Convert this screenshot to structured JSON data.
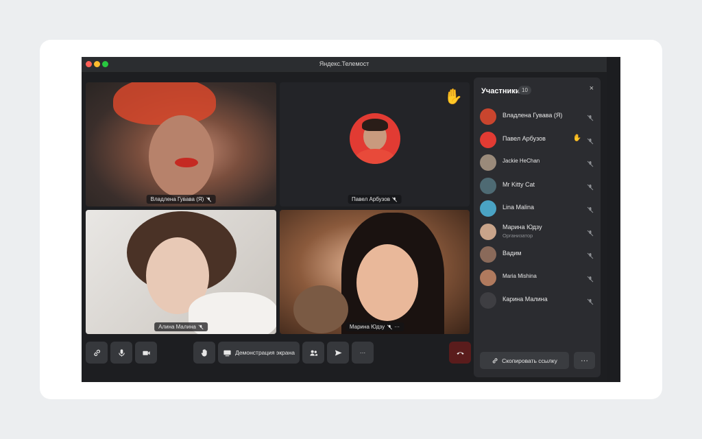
{
  "window": {
    "title": "Яндекс.Телемост"
  },
  "tiles": [
    {
      "label": "Владлена Гувава (Я)"
    },
    {
      "label": "Павел Арбузов"
    },
    {
      "label": "Алина Малина"
    },
    {
      "label": "Марина Юдзу"
    }
  ],
  "controls": {
    "link_icon": "link-icon",
    "mic_icon": "microphone-icon",
    "camera_icon": "camera-icon",
    "hand_icon": "raise-hand-icon",
    "screen_share_label": "Демонстрация экрана",
    "participants_icon": "participants-icon",
    "send_icon": "send-icon",
    "more_label": "···",
    "end_call_icon": "end-call-icon"
  },
  "panel": {
    "title": "Участники",
    "count": "10",
    "close_label": "×",
    "participants": [
      {
        "name": "Владлена Гувава (Я)",
        "role": "",
        "hand": false,
        "color": "#c9452e"
      },
      {
        "name": "Павел Арбузов",
        "role": "",
        "hand": true,
        "color": "#e23b33"
      },
      {
        "name": "Jackie HeChan",
        "role": "",
        "hand": false,
        "color": "#9a8a7a"
      },
      {
        "name": "Mr Kitty Cat",
        "role": "",
        "hand": false,
        "color": "#4e6a73"
      },
      {
        "name": "Lina Malina",
        "role": "",
        "hand": false,
        "color": "#4aa3c4"
      },
      {
        "name": "Марина Юдзу",
        "role": "Организатор",
        "hand": false,
        "color": "#c9a48a"
      },
      {
        "name": "Вадим",
        "role": "",
        "hand": false,
        "color": "#8a6a5a"
      },
      {
        "name": "Maria Mishina",
        "role": "",
        "hand": false,
        "color": "#b07a5e"
      },
      {
        "name": "Карина Малина",
        "role": "",
        "hand": false,
        "color": "#3e3e42"
      }
    ],
    "copy_link_label": "Скопировать ссылку",
    "more_label": "···"
  },
  "colors": {
    "end_call": "#5a1c1c",
    "accent_avatar": "#e23b33"
  }
}
